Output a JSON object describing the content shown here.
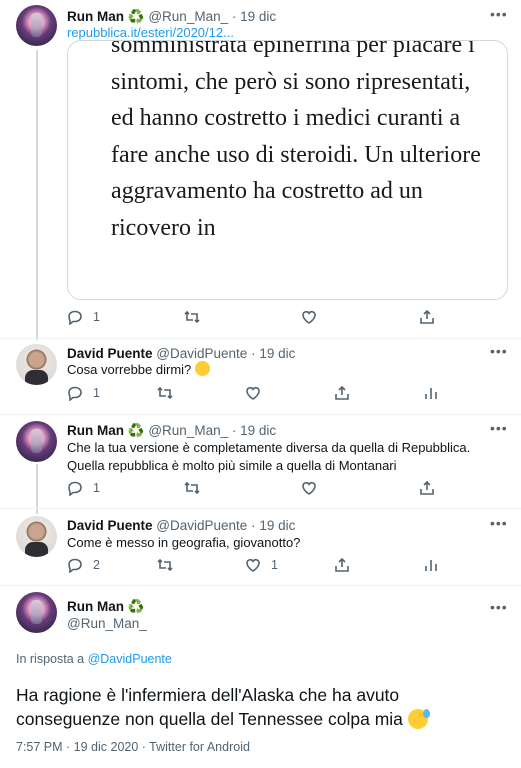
{
  "tweets": [
    {
      "name": "Run Man",
      "badge": "♻️",
      "handle": "@Run_Man_",
      "dot": "·",
      "date": "19 dic",
      "link": "repubblica.it/esteri/2020/12...",
      "quote_text": "somministrata epinefrina per placare i sintomi, che però si sono ripresentati, ed hanno costretto i medici curanti a fare anche uso di steroidi. Un ulteriore aggravamento ha costretto ad un ricovero in",
      "actions": {
        "reply": "1",
        "retweet": "",
        "like": ""
      }
    },
    {
      "name": "David Puente",
      "handle": "@DavidPuente",
      "dot": "·",
      "date": "19 dic",
      "text": "Cosa vorrebbe dirmi?",
      "actions": {
        "reply": "1",
        "retweet": "",
        "like": ""
      }
    },
    {
      "name": "Run Man",
      "badge": "♻️",
      "handle": "@Run_Man_",
      "dot": "·",
      "date": "19 dic",
      "text": "Che la tua versione è completamente diversa da quella di Repubblica. Quella repubblica è molto più simile a quella di Montanari",
      "actions": {
        "reply": "1",
        "retweet": "",
        "like": ""
      }
    },
    {
      "name": "David Puente",
      "handle": "@DavidPuente",
      "dot": "·",
      "date": "19 dic",
      "text": "Come è messo in geografia, giovanotto?",
      "actions": {
        "reply": "2",
        "retweet": "",
        "like": "1"
      }
    }
  ],
  "main_tweet": {
    "name": "Run Man",
    "badge": "♻️",
    "handle": "@Run_Man_",
    "reply_to_prefix": "In risposta a",
    "reply_to_handle": "@DavidPuente",
    "text": "Ha ragione è l'infermiera dell'Alaska che ha avuto conseguenze non quella del Tennessee colpa mia",
    "meta": "7:57 PM · 19 dic 2020 · Twitter for Android"
  },
  "icons": [
    "reply-icon",
    "retweet-icon",
    "like-icon",
    "share-icon",
    "analytics-icon",
    "more-icon"
  ],
  "colors": {
    "link": "#1d9bf0",
    "secondary": "#536471",
    "border": "#cfd9de"
  }
}
